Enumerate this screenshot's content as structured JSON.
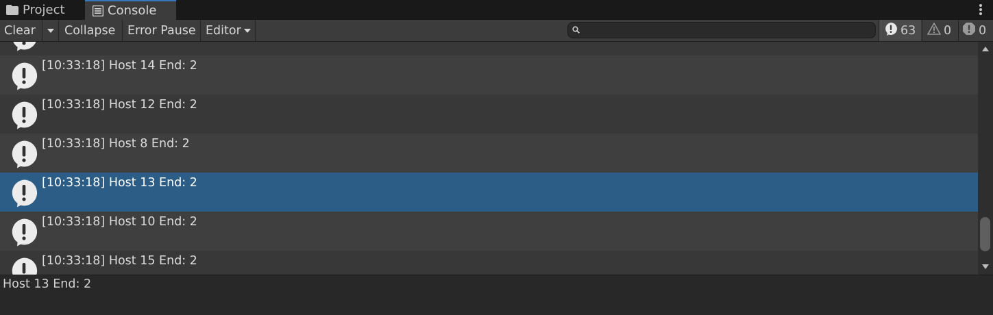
{
  "tabs": {
    "project": "Project",
    "console": "Console"
  },
  "toolbar": {
    "clear": "Clear",
    "collapse": "Collapse",
    "error_pause": "Error Pause",
    "editor": "Editor",
    "search_value": "",
    "log_count": "63",
    "warning_count": "0",
    "error_count": "0"
  },
  "logs": [
    {
      "message": "",
      "selected": false
    },
    {
      "message": "[10:33:18] Host 14 End: 2",
      "selected": false
    },
    {
      "message": "[10:33:18] Host 12 End: 2",
      "selected": false
    },
    {
      "message": "[10:33:18] Host 8 End: 2",
      "selected": false
    },
    {
      "message": "[10:33:18] Host 13 End: 2",
      "selected": true
    },
    {
      "message": "[10:33:18] Host 10 End: 2",
      "selected": false
    },
    {
      "message": "[10:33:18] Host 15 End: 2",
      "selected": false
    }
  ],
  "detail": {
    "text": "Host 13 End: 2"
  },
  "colors": {
    "selected_row": "#2c5d87",
    "tab_accent": "#3a79bb"
  }
}
